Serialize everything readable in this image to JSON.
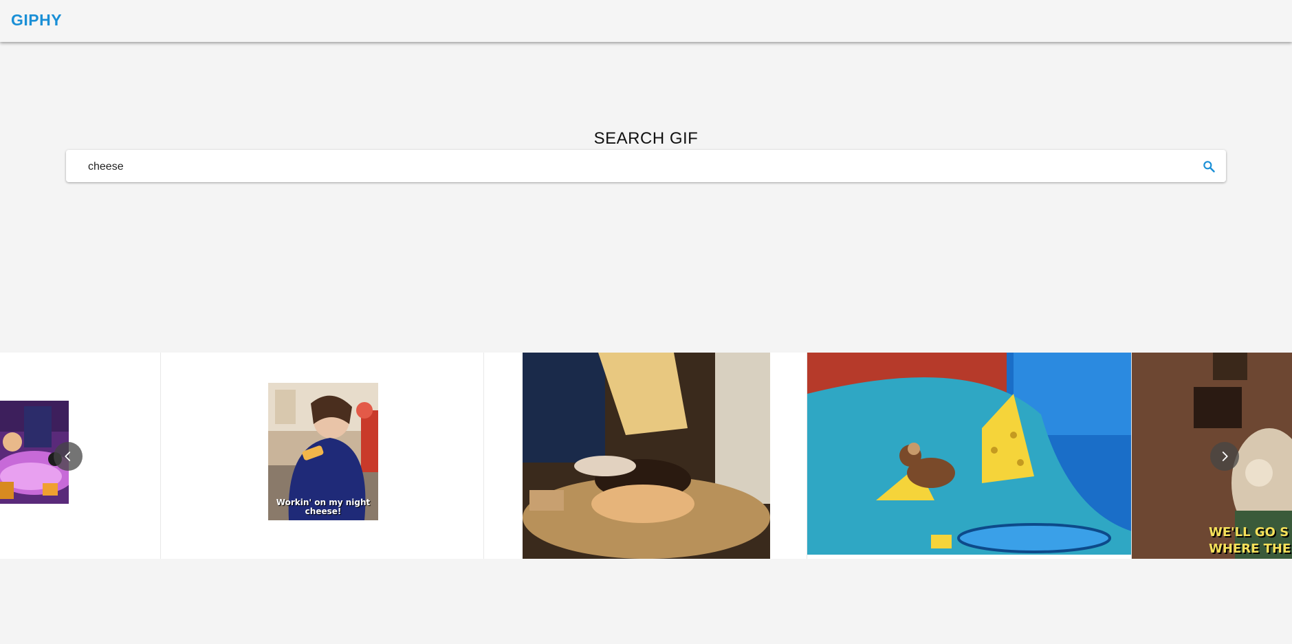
{
  "app": {
    "logo": "GIPHY",
    "brand_color": "#1a8fd6"
  },
  "search": {
    "title": "SEARCH GIF",
    "value": "cheese",
    "icon": "search-icon"
  },
  "carousel": {
    "prev_icon": "chevron-left-icon",
    "next_icon": "chevron-right-icon",
    "slides": [
      {
        "name": "gif-cartoon-party",
        "caption": ""
      },
      {
        "name": "gif-night-cheese",
        "caption": "Workin' on my night cheese!"
      },
      {
        "name": "gif-cheese-burger",
        "caption": ""
      },
      {
        "name": "gif-jerry-cheese",
        "caption": ""
      },
      {
        "name": "gif-wallace",
        "caption": "WE'LL GO S\nWHERE THE"
      }
    ]
  }
}
